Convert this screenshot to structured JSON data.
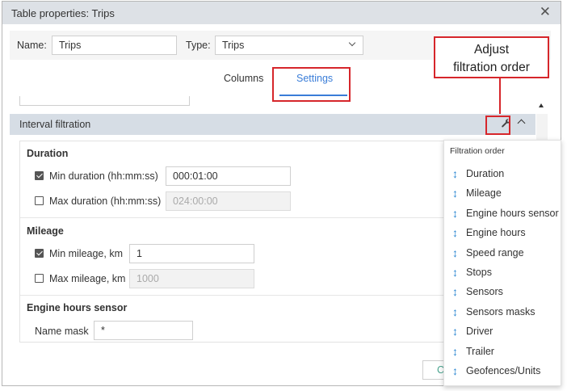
{
  "dialog": {
    "title": "Table properties: Trips",
    "close_icon": "✕"
  },
  "name_row": {
    "name_label": "Name:",
    "name_value": "Trips",
    "type_label": "Type:",
    "type_value": "Trips"
  },
  "tabs": [
    {
      "label": "Columns",
      "active": false
    },
    {
      "label": "Settings",
      "active": true
    }
  ],
  "callout": {
    "line1": "Adjust",
    "line2": "filtration order",
    "color": "#d6262b"
  },
  "section": {
    "title": "Interval filtration",
    "wrench_icon": "wrench-icon",
    "collapse_icon": "chevron-up-icon"
  },
  "duration": {
    "title": "Duration",
    "min": {
      "label": "Min duration (hh:mm:ss)",
      "checked": true,
      "value": "000:01:00"
    },
    "max": {
      "label": "Max duration (hh:mm:ss)",
      "checked": false,
      "value": "024:00:00"
    }
  },
  "mileage": {
    "title": "Mileage",
    "min": {
      "label": "Min mileage, km",
      "checked": true,
      "value": "1"
    },
    "max": {
      "label": "Max mileage, km",
      "checked": false,
      "value": "1000"
    }
  },
  "engine_hours_sensor": {
    "title": "Engine hours sensor",
    "mask_label": "Name mask",
    "mask_value": "*"
  },
  "filtration_order": {
    "title": "Filtration order",
    "icon": "↕",
    "items": [
      "Duration",
      "Mileage",
      "Engine hours sensor",
      "Engine hours",
      "Speed range",
      "Stops",
      "Sensors",
      "Sensors masks",
      "Driver",
      "Trailer",
      "Geofences/Units"
    ]
  },
  "footer": {
    "partial_button_label": "C"
  },
  "colors": {
    "accent": "#3a7dd8",
    "highlight_red": "#d6262b",
    "section_bg": "#d6dde5",
    "drag_icon": "#2a86d1"
  }
}
